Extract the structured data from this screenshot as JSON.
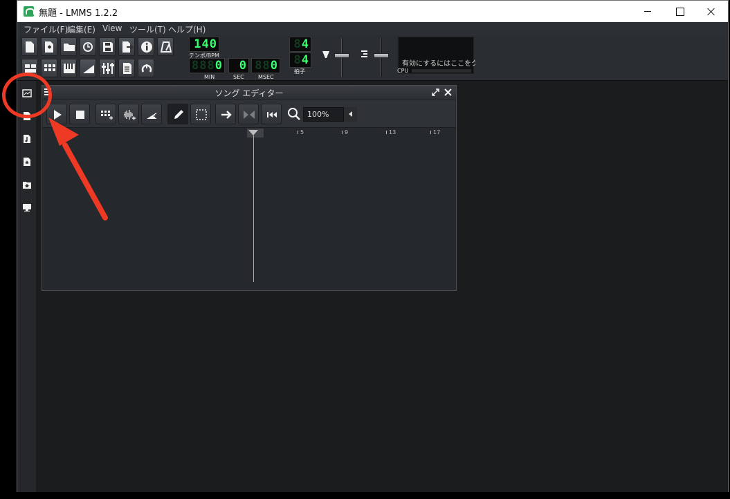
{
  "window": {
    "title": "無題 - LMMS 1.2.2"
  },
  "menubar": {
    "items": [
      "ファイル(F)",
      "編集(E)",
      "View",
      "ツール(T)",
      "ヘルプ(H)"
    ]
  },
  "toolbar": {
    "tempo": {
      "value": "140",
      "dim_prefix": "",
      "label": "テンポ/BPM"
    },
    "time_min": {
      "dim": "888",
      "value": "0",
      "label": "MIN"
    },
    "time_sec": {
      "dim": "",
      "value": "0",
      "label": "SEC"
    },
    "time_msec": {
      "dim": "88",
      "value": "0",
      "label": "MSEC"
    },
    "time_sig_num": {
      "value": "4",
      "dim": "8"
    },
    "time_sig_den": {
      "value": "4",
      "dim": "8"
    },
    "time_sig_label": "拍子",
    "cpu_hint": "有効にするにはここをクリック",
    "cpu_label": "CPU"
  },
  "song_editor": {
    "title": "ソング エディター",
    "zoom": "100%",
    "ruler_marks": [
      "5",
      "9",
      "13",
      "17"
    ]
  },
  "colors": {
    "accent_annotation": "#ee3a24",
    "lcd_green": "#37ff6e",
    "background": "#1b1c1e"
  },
  "icons": {
    "sidebar": [
      "instrument-plugins-icon",
      "my-projects-icon",
      "my-samples-icon",
      "my-presets-icon",
      "my-home-icon",
      "root-directory-icon"
    ]
  }
}
